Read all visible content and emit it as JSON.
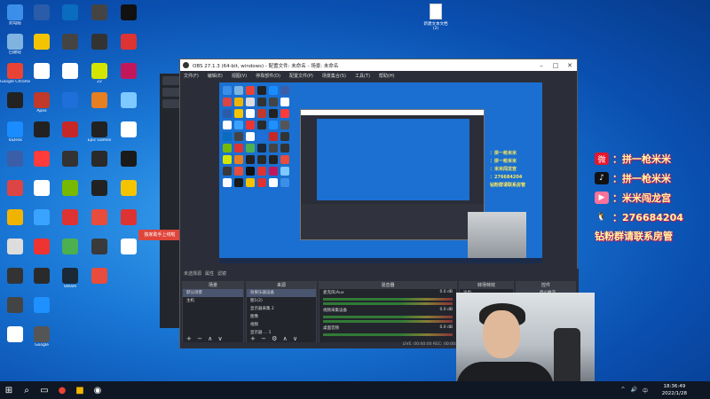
{
  "desktop": {
    "columns": [
      [
        {
          "label": "此电脑",
          "icon": "computer-icon",
          "color": "#3b8fe8"
        },
        {
          "label": "回收站",
          "icon": "recycle-bin-icon",
          "color": "#7fb3e0"
        },
        {
          "label": "Google Chrome",
          "icon": "chrome-icon",
          "color": "#e94335"
        },
        {
          "label": "",
          "icon": "app-icon",
          "color": "#222222"
        },
        {
          "label": "ToDesk",
          "icon": "todesk-icon",
          "color": "#1a8cff"
        },
        {
          "label": "",
          "icon": "app-icon",
          "color": "#3a5fa8"
        },
        {
          "label": "",
          "icon": "app-icon",
          "color": "#d44"
        },
        {
          "label": "",
          "icon": "app-icon",
          "color": "#f0b400"
        },
        {
          "label": "",
          "icon": "app-icon",
          "color": "#ddd"
        },
        {
          "label": "",
          "icon": "app-icon",
          "color": "#333"
        },
        {
          "label": "",
          "icon": "app-icon",
          "color": "#444"
        },
        {
          "label": "",
          "icon": "app-icon",
          "color": "#fff"
        }
      ],
      [
        {
          "label": "",
          "icon": "app-icon",
          "color": "#2a5caa"
        },
        {
          "label": "",
          "icon": "app-icon",
          "color": "#f5c400"
        },
        {
          "label": "",
          "icon": "file-icon",
          "color": "#fff"
        },
        {
          "label": "Apex",
          "icon": "apex-icon",
          "color": "#c0392b"
        },
        {
          "label": "",
          "icon": "app-icon",
          "color": "#222"
        },
        {
          "label": "",
          "icon": "app-icon",
          "color": "#ff3b3b"
        },
        {
          "label": "",
          "icon": "app-icon",
          "color": "#ffffff"
        },
        {
          "label": "",
          "icon": "app-icon",
          "color": "#3aa3ff"
        },
        {
          "label": "",
          "icon": "app-icon",
          "color": "#e33"
        },
        {
          "label": "",
          "icon": "app-icon",
          "color": "#2a2a2a"
        },
        {
          "label": "",
          "icon": "app-icon",
          "color": "#1e90ff"
        },
        {
          "label": "Google",
          "icon": "app-icon",
          "color": "#555"
        }
      ],
      [
        {
          "label": "",
          "icon": "app-icon",
          "color": "#0a6cbe"
        },
        {
          "label": "",
          "icon": "app-icon",
          "color": "#444"
        },
        {
          "label": "",
          "icon": "file-icon",
          "color": "#fff"
        },
        {
          "label": "",
          "icon": "app-icon",
          "color": "#1e6fd9"
        },
        {
          "label": "",
          "icon": "app-icon",
          "color": "#c62828"
        },
        {
          "label": "",
          "icon": "app-icon",
          "color": "#333"
        },
        {
          "label": "",
          "icon": "nvidia-icon",
          "color": "#76b900"
        },
        {
          "label": "",
          "icon": "app-icon",
          "color": "#dd3333"
        },
        {
          "label": "",
          "icon": "app-icon",
          "color": "#4caf50"
        },
        {
          "label": "Steam",
          "icon": "steam-icon",
          "color": "#1b2838"
        }
      ],
      [
        {
          "label": "",
          "icon": "app-icon",
          "color": "#444"
        },
        {
          "label": "",
          "icon": "app-icon",
          "color": "#333"
        },
        {
          "label": "22",
          "icon": "app-icon",
          "color": "#d4e600"
        },
        {
          "label": "",
          "icon": "app-icon",
          "color": "#e67e22"
        },
        {
          "label": "Epic Games",
          "icon": "epic-icon",
          "color": "#222"
        },
        {
          "label": "",
          "icon": "app-icon",
          "color": "#2a2a2a"
        },
        {
          "label": "",
          "icon": "obs-icon",
          "color": "#222"
        },
        {
          "label": "",
          "icon": "app-icon",
          "color": "#e74c3c"
        },
        {
          "label": "",
          "icon": "app-icon",
          "color": "#3a3a3a"
        },
        {
          "label": "",
          "icon": "app-icon",
          "color": "#e74c3c"
        }
      ],
      [
        {
          "label": "",
          "icon": "app-icon",
          "color": "#111"
        },
        {
          "label": "",
          "icon": "app-icon",
          "color": "#dd3333"
        },
        {
          "label": "",
          "icon": "app-icon",
          "color": "#c2185b"
        },
        {
          "label": "",
          "icon": "app-icon",
          "color": "#7ec9ff"
        },
        {
          "label": "",
          "icon": "app-icon",
          "color": "#fff"
        },
        {
          "label": "",
          "icon": "app-icon",
          "color": "#1a1a1a"
        },
        {
          "label": "",
          "icon": "app-icon",
          "color": "#f5c400"
        },
        {
          "label": "",
          "icon": "app-icon",
          "color": "#dd3333"
        },
        {
          "label": "",
          "icon": "app-icon",
          "color": "#fff"
        }
      ]
    ],
    "file_label": "新建文本文档 (2)"
  },
  "obs": {
    "title": "OBS 27.1.3 (64-bit, windows) - 配置文件: 未命名 - 场景: 未命名",
    "menu": [
      "文件(F)",
      "编辑(E)",
      "视图(V)",
      "停靠部件(D)",
      "配置文件(P)",
      "场景集合(S)",
      "工具(T)",
      "帮助(H)"
    ],
    "dock_tabs": [
      "未选择源",
      "属性",
      "滤镜"
    ],
    "scenes": {
      "title": "场景",
      "items": [
        "默认场景",
        "主机"
      ]
    },
    "sources": {
      "title": "来源",
      "items": [
        "效果乐器设备",
        "图1(2)",
        "显示器采集 2",
        "图像",
        "视频",
        "显示器 ... 1"
      ]
    },
    "mixer": {
      "title": "混音器",
      "channels": [
        {
          "name": "麦克风/Aux",
          "value": "0.0 dB"
        },
        {
          "name": "视频采集设备",
          "value": "0.0 dB"
        },
        {
          "name": "桌面音频",
          "value": "0.0 dB"
        }
      ]
    },
    "transitions": {
      "title": "转场特效",
      "value": "淡出"
    },
    "controls": {
      "title": "控件",
      "stop_label": "停止推流"
    },
    "status": "LIVE: 00:00:00  REC: 00:00:00  CPU: 12.0%, 30.00 fps"
  },
  "back_window": {
    "toast": "独家助手上线啦"
  },
  "social": {
    "weibo": "：拼一枪米米",
    "douyin": "：拼一枪米米",
    "bilibili": "：米米闯龙宫",
    "qq": "：276684204",
    "group": "钻粉群请联系房管"
  },
  "taskbar": {
    "time": "18:36:49",
    "date": "2022/1/28"
  }
}
